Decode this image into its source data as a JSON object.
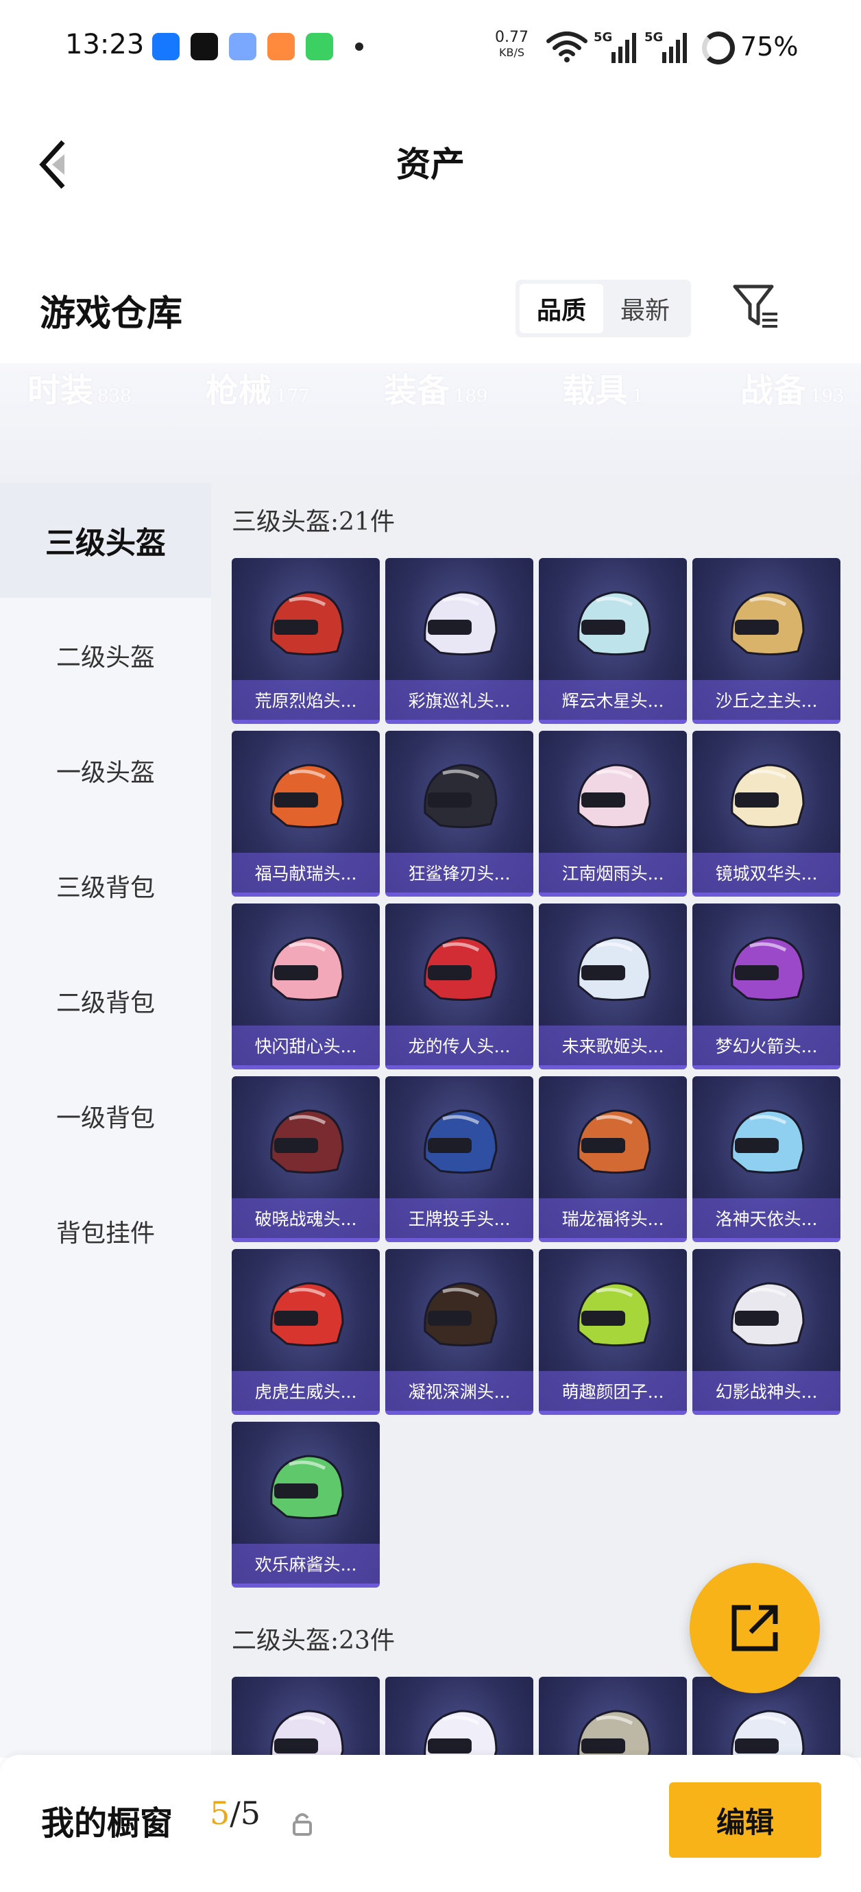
{
  "status": {
    "time": "13:23",
    "net_speed_value": "0.77",
    "net_speed_unit": "KB/S",
    "signal1_label": "5G",
    "signal2_label": "5G",
    "battery": "75%",
    "app_icons": [
      "alipay-icon",
      "tiktok-icon",
      "gallery-icon",
      "video-app-icon",
      "message-icon"
    ],
    "app_icon_colors": [
      "#1677ff",
      "#111111",
      "#7aa7ff",
      "#ff8a3d",
      "#3ccf62"
    ]
  },
  "header": {
    "title": "资产"
  },
  "section": {
    "title": "游戏仓库",
    "sort_options": [
      "品质",
      "最新"
    ],
    "active_sort": "品质"
  },
  "category_tabs": [
    {
      "label": "时装",
      "count": "838"
    },
    {
      "label": "枪械",
      "count": "177"
    },
    {
      "label": "装备",
      "count": "189"
    },
    {
      "label": "载具",
      "count": "1"
    },
    {
      "label": "战备",
      "count": "193"
    }
  ],
  "sidebar": {
    "items": [
      "三级头盔",
      "二级头盔",
      "一级头盔",
      "三级背包",
      "二级背包",
      "一级背包",
      "背包挂件"
    ],
    "active": "三级头盔"
  },
  "groups": [
    {
      "title": "三级头盔:21件",
      "items": [
        {
          "name": "荒原烈焰头...",
          "color": "#c8352a"
        },
        {
          "name": "彩旗巡礼头...",
          "color": "#e9e6f5"
        },
        {
          "name": "辉云木星头...",
          "color": "#bfe3ea"
        },
        {
          "name": "沙丘之主头...",
          "color": "#d9b36a"
        },
        {
          "name": "福马献瑞头...",
          "color": "#e2632c"
        },
        {
          "name": "狂鲨锋刃头...",
          "color": "#2b2b35"
        },
        {
          "name": "江南烟雨头...",
          "color": "#f1d6e3"
        },
        {
          "name": "镜城双华头...",
          "color": "#f3e7c6"
        },
        {
          "name": "快闪甜心头...",
          "color": "#f2a8b8"
        },
        {
          "name": "龙的传人头...",
          "color": "#d22d35"
        },
        {
          "name": "未来歌姬头...",
          "color": "#dfe9f5"
        },
        {
          "name": "梦幻火箭头...",
          "color": "#9b49c9"
        },
        {
          "name": "破晓战魂头...",
          "color": "#7a2b2f"
        },
        {
          "name": "王牌投手头...",
          "color": "#2f4fa3"
        },
        {
          "name": "瑞龙福将头...",
          "color": "#d36a33"
        },
        {
          "name": "洛神天依头...",
          "color": "#8fd0f0"
        },
        {
          "name": "虎虎生威头...",
          "color": "#d8352e"
        },
        {
          "name": "凝视深渊头...",
          "color": "#3a2a22"
        },
        {
          "name": "萌趣颜团子...",
          "color": "#a6d63a"
        },
        {
          "name": "幻影战神头...",
          "color": "#e8e8ee"
        },
        {
          "name": "欢乐麻酱头...",
          "color": "#5fc86a"
        }
      ]
    },
    {
      "title": "二级头盔:23件",
      "items": [
        {
          "name": "",
          "color": "#e8e0f3"
        },
        {
          "name": "",
          "color": "#f0eef8"
        },
        {
          "name": "",
          "color": "#bdb8a5"
        },
        {
          "name": "",
          "color": "#e6ebf5"
        }
      ]
    }
  ],
  "bottom": {
    "window_label": "我的橱窗",
    "window_current": "5",
    "window_total": "/5",
    "edit_label": "编辑"
  }
}
